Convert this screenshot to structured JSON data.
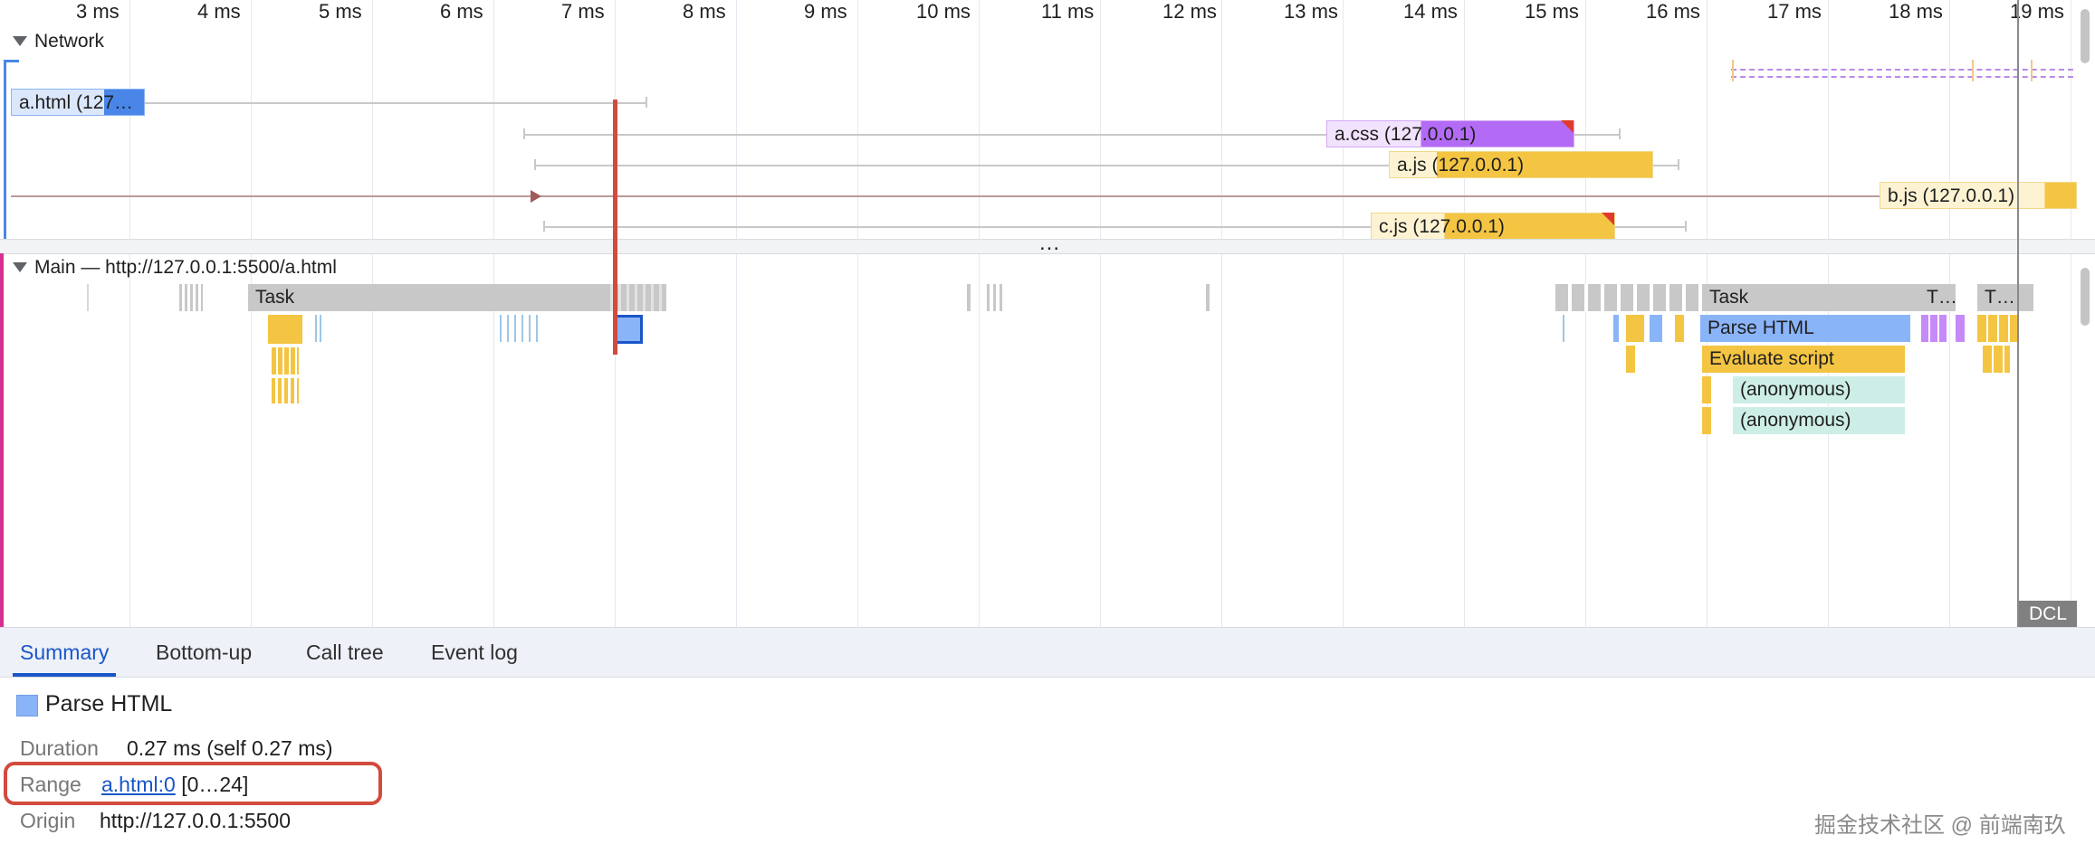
{
  "ruler": {
    "ticks": [
      "3 ms",
      "4 ms",
      "5 ms",
      "6 ms",
      "7 ms",
      "8 ms",
      "9 ms",
      "10 ms",
      "11 ms",
      "12 ms",
      "13 ms",
      "14 ms",
      "15 ms",
      "16 ms",
      "17 ms",
      "18 ms",
      "19 ms"
    ]
  },
  "network": {
    "title": "Network",
    "requests": [
      {
        "label": "a.html (127…"
      },
      {
        "label": "a.css (127.0.0.1)"
      },
      {
        "label": "a.js (127.0.0.1)"
      },
      {
        "label": "b.js (127.0.0.1)"
      },
      {
        "label": "c.js (127.0.0.1)"
      }
    ],
    "more_label": "..."
  },
  "main": {
    "title": "Main — http://127.0.0.1:5500/a.html",
    "events": {
      "task_left": "Task",
      "task_right": "Task",
      "task_short_1": "T…",
      "task_short_2": "T…",
      "parse_html": "Parse HTML",
      "evaluate_script": "Evaluate script",
      "anonymous_1": "(anonymous)",
      "anonymous_2": "(anonymous)"
    },
    "dcl_label": "DCL"
  },
  "tabs": [
    "Summary",
    "Bottom-up",
    "Call tree",
    "Event log"
  ],
  "summary": {
    "title": "Parse HTML",
    "swatch_color": "#8ab4f8",
    "duration_label": "Duration",
    "duration_value": "0.27 ms (self 0.27 ms)",
    "range_label": "Range",
    "range_link": "a.html:0",
    "range_value": "[0…24]",
    "origin_label": "Origin",
    "origin_value": "http://127.0.0.1:5500"
  },
  "watermark": "掘金技术社区 @ 前端南玖",
  "colors": {
    "html": "#4a86e8",
    "css": "#b36bf5",
    "script": "#f4c542",
    "task": "#c8c8c8",
    "anonymous": "#cdeee6",
    "accent": "#1a56c8",
    "highlight": "#d24b3e"
  }
}
